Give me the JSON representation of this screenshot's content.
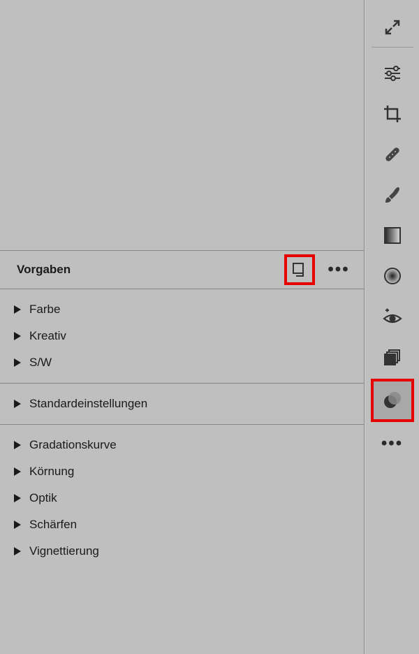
{
  "panel": {
    "title": "Vorgaben"
  },
  "sections": [
    {
      "items": [
        {
          "label": "Farbe"
        },
        {
          "label": "Kreativ"
        },
        {
          "label": "S/W"
        }
      ]
    },
    {
      "items": [
        {
          "label": "Standardeinstellungen"
        }
      ]
    },
    {
      "items": [
        {
          "label": "Gradationskurve"
        },
        {
          "label": "Körnung"
        },
        {
          "label": "Optik"
        },
        {
          "label": "Schärfen"
        },
        {
          "label": "Vignettierung"
        }
      ]
    }
  ],
  "toolbar": {
    "icons": [
      "collapse-icon",
      "sliders-icon",
      "crop-icon",
      "heal-icon",
      "brush-icon",
      "linear-gradient-icon",
      "radial-gradient-icon",
      "redeye-icon",
      "layers-icon",
      "presets-icon",
      "more-icon"
    ]
  }
}
